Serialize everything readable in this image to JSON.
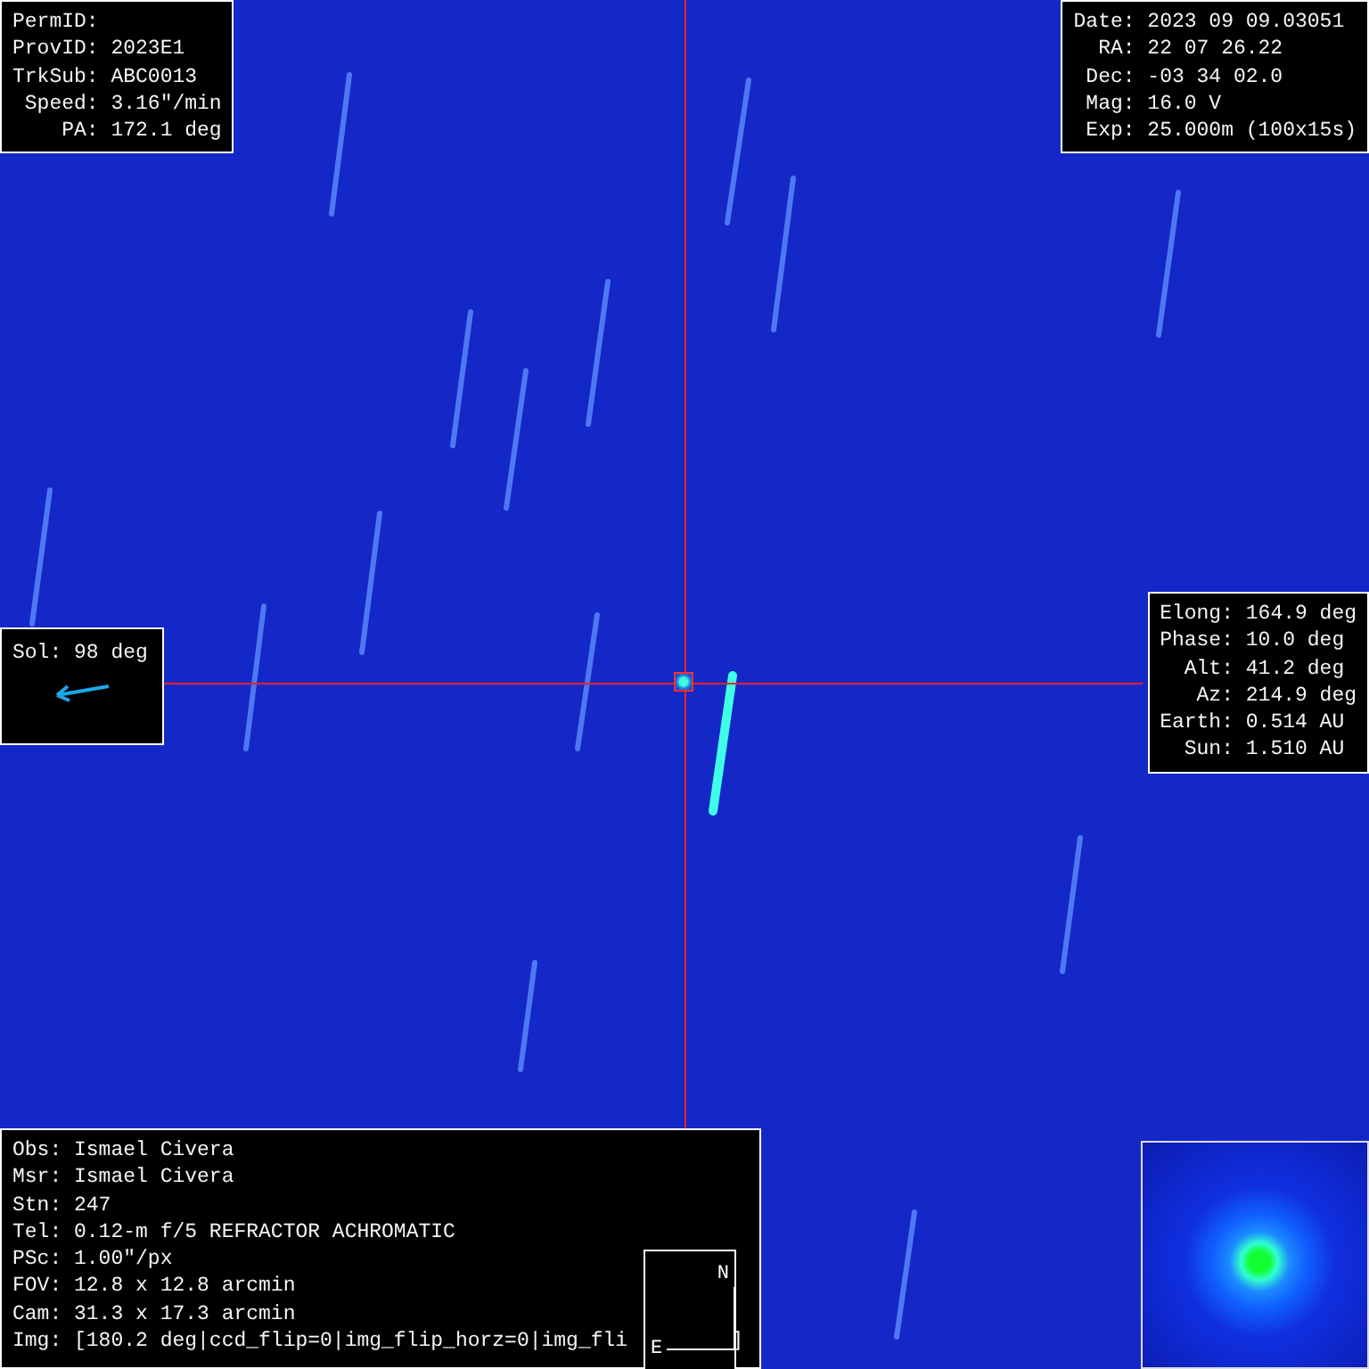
{
  "object_panel": {
    "lines": [
      "PermID:",
      "ProvID: 2023E1",
      "TrkSub: ABC0013",
      " Speed: 3.16\"/min",
      "    PA: 172.1 deg"
    ]
  },
  "observation_panel": {
    "lines": [
      "Date: 2023 09 09.03051",
      "  RA: 22 07 26.22",
      " Dec: -03 34 02.0",
      " Mag: 16.0 V",
      " Exp: 25.000m (100x15s)"
    ]
  },
  "solar_panel": {
    "label": "Sol: 98 deg"
  },
  "geometry_panel": {
    "lines": [
      "Elong: 164.9 deg",
      "Phase: 10.0 deg",
      "  Alt: 41.2 deg",
      "   Az: 214.9 deg",
      "Earth: 0.514 AU",
      "  Sun: 1.510 AU"
    ]
  },
  "station_panel": {
    "lines": [
      "Obs: Ismael Civera",
      "Msr: Ismael Civera",
      "Stn: 247",
      "Tel: 0.12-m f/5 REFRACTOR ACHROMATIC",
      "PSc: 1.00\"/px",
      "FOV: 12.8 x 12.8 arcmin",
      "Cam: 31.3 x 17.3 arcmin"
    ],
    "img_line": "Img: [180.2 deg|ccd_flip=0|img_flip_horz=0|img_fli",
    "img_line_end": "]"
  },
  "compass": {
    "north": "N",
    "east": "E"
  }
}
